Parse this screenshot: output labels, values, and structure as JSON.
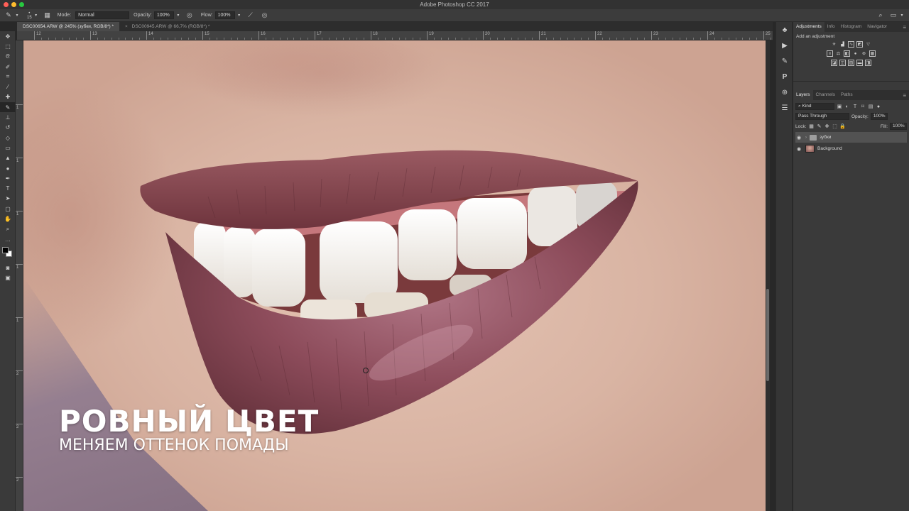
{
  "window": {
    "title": "Adobe Photoshop CC 2017"
  },
  "options_bar": {
    "brush_size": "15",
    "mode_label": "Mode:",
    "mode_value": "Normal",
    "opacity_label": "Opacity:",
    "opacity_value": "100%",
    "flow_label": "Flow:",
    "flow_value": "100%"
  },
  "tabs": [
    {
      "label": "DSC00654.ARW @ 245% (зубки, RGB/8*) *",
      "active": true
    },
    {
      "label": "DSC00945.ARW @ 66,7% (RGB/8*) *",
      "active": false
    }
  ],
  "ruler": {
    "top": [
      "12",
      "13",
      "14",
      "15",
      "16",
      "17",
      "18",
      "19",
      "20",
      "21",
      "22",
      "23",
      "24",
      "25"
    ],
    "left": [
      "1",
      "1",
      "1",
      "1",
      "1",
      "2",
      "2",
      "2"
    ]
  },
  "canvas": {
    "title": "РОВНЫЙ ЦВЕТ",
    "subtitle": "МЕНЯЕМ ОТТЕНОК ПОМАДЫ"
  },
  "adjustments_panel": {
    "tabs": [
      "Adjustments",
      "Info",
      "Histogram",
      "Navigator"
    ],
    "label": "Add an adjustment"
  },
  "layers_panel": {
    "tabs": [
      "Layers",
      "Channels",
      "Paths"
    ],
    "filter_kind": "Kind",
    "blend_mode": "Pass Through",
    "opacity_label": "Opacity:",
    "opacity_value": "100%",
    "lock_label": "Lock:",
    "fill_label": "Fill:",
    "fill_value": "100%",
    "layers": [
      {
        "name": "зубки",
        "type": "group",
        "selected": true
      },
      {
        "name": "Background",
        "type": "image",
        "selected": false
      }
    ]
  },
  "colors": {
    "ui_dark": "#282828",
    "panel": "#3a3a3a",
    "lip": "#8a4a55",
    "skin": "#e0bfae"
  }
}
